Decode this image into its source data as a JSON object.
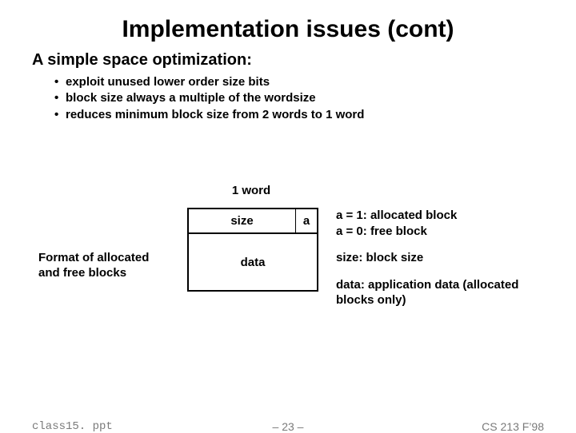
{
  "title": "Implementation issues (cont)",
  "subhead": "A simple space optimization:",
  "bullets": [
    "exploit unused lower order size bits",
    "block size always a multiple of the wordsize",
    "reduces minimum block size from 2 words to 1 word"
  ],
  "diagram": {
    "word_label": "1 word",
    "size_cell": "size",
    "a_cell": "a",
    "data_cell": "data",
    "left_caption": "Format of allocated and free blocks",
    "legend": {
      "a1": "a = 1: allocated block",
      "a0": "a = 0: free block",
      "size": "size: block size",
      "data": "data: application data (allocated blocks only)"
    }
  },
  "footer": {
    "filename": "class15. ppt",
    "page": "– 23 –",
    "course": "CS 213 F’98"
  }
}
